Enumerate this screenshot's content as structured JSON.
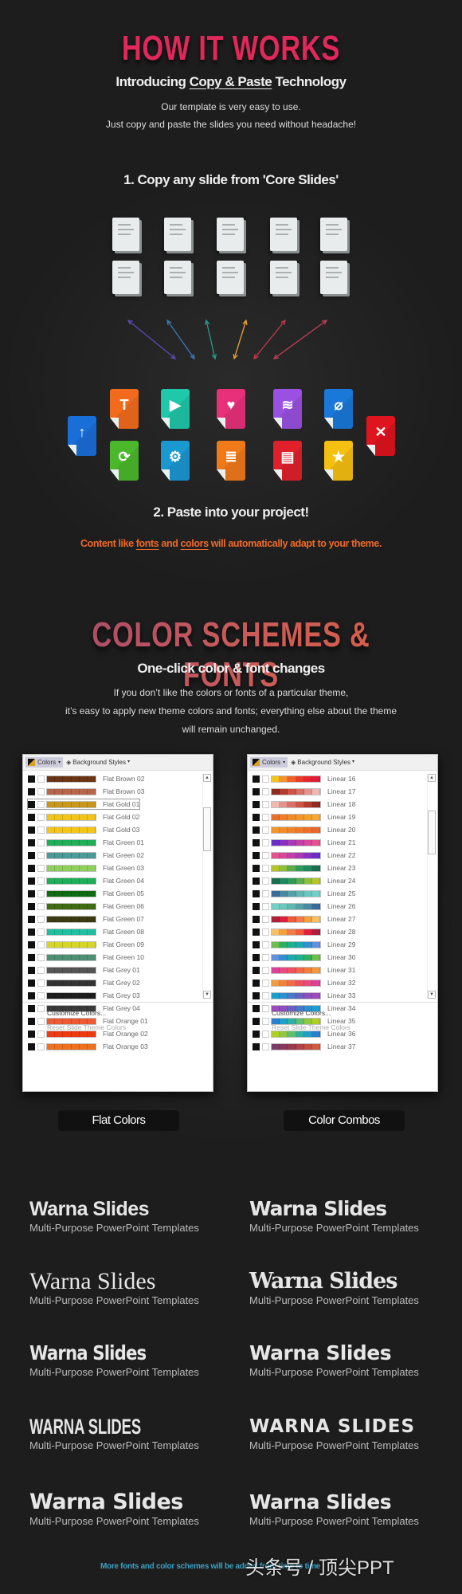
{
  "how": {
    "title": "HOW IT WORKS",
    "subtitle_pre": "Introducing ",
    "subtitle_link": "Copy & Paste",
    "subtitle_post": " Technology",
    "body_lines": [
      "Our template is very easy to use.",
      "Just copy and paste the slides you need without headache!"
    ],
    "step1": "1. Copy any slide from 'Core Slides'",
    "step2": "2. Paste into your project!",
    "adapt_pre": "Content like ",
    "adapt_fonts": "fonts",
    "adapt_mid": " and ",
    "adapt_colors": "colors",
    "adapt_post": " will automatically adapt to your theme.",
    "title_color": "#e0285a",
    "adapt_color": "#ee6a2a"
  },
  "doc_icon_count": 10,
  "arrow_colors": [
    "#5a4ab8",
    "#3a7ab8",
    "#2a9a8a",
    "#e8a030",
    "#c03a4a",
    "#c0405a"
  ],
  "file_icons": [
    {
      "name": "text",
      "glyph": "T",
      "color": "#f26b1d"
    },
    {
      "name": "play",
      "glyph": "▶",
      "color": "#1fc8a8"
    },
    {
      "name": "heart",
      "glyph": "♥",
      "color": "#e8307a"
    },
    {
      "name": "wifi",
      "glyph": "≋",
      "color": "#9a50e0"
    },
    {
      "name": "paperclip",
      "glyph": "⌀",
      "color": "#1a78d8"
    },
    {
      "name": "refresh",
      "glyph": "⟳",
      "color": "#4ab82a"
    },
    {
      "name": "gear",
      "glyph": "⚙",
      "color": "#1a98d0"
    },
    {
      "name": "document",
      "glyph": "≣",
      "color": "#f07a1a"
    },
    {
      "name": "table",
      "glyph": "▤",
      "color": "#e0202a"
    },
    {
      "name": "star",
      "glyph": "★",
      "color": "#f5c010"
    },
    {
      "name": "upload",
      "glyph": "↑",
      "color": "#1a6ed8"
    },
    {
      "name": "close",
      "glyph": "✕",
      "color": "#e0141e"
    }
  ],
  "schemes": {
    "title": "COLOR SCHEMES & FONTS",
    "subtitle": "One-click color & font changes",
    "body_lines": [
      "If you don’t like the colors or fonts of a particular theme,",
      "it’s easy to apply new theme colors and fonts; everything else about the theme",
      "will remain unchanged."
    ]
  },
  "panel_common": {
    "colors_btn": "Colors",
    "bg_styles": "Background Styles",
    "customize": "Customize Colors...",
    "reset": "Reset Slide Theme Colors"
  },
  "flat_panel": {
    "label": "Flat Colors",
    "rows": [
      {
        "name": "Flat Brown 02",
        "colors": [
          "#6b3515"
        ]
      },
      {
        "name": "Flat Brown 03",
        "colors": [
          "#b8664a"
        ]
      },
      {
        "name": "Flat Gold 01",
        "colors": [
          "#c9981a"
        ]
      },
      {
        "name": "Flat Gold 02",
        "colors": [
          "#f2c419"
        ]
      },
      {
        "name": "Flat Gold 03",
        "colors": [
          "#f5c518"
        ]
      },
      {
        "name": "Flat Green 01",
        "colors": [
          "#1fae5a"
        ]
      },
      {
        "name": "Flat Green 02",
        "colors": [
          "#4a9b98"
        ]
      },
      {
        "name": "Flat Green 03",
        "colors": [
          "#8fd05a"
        ]
      },
      {
        "name": "Flat Green 04",
        "colors": [
          "#1fae5a"
        ]
      },
      {
        "name": "Flat Green 05",
        "colors": [
          "#0e6b12"
        ]
      },
      {
        "name": "Flat Green 06",
        "colors": [
          "#3f6b12"
        ]
      },
      {
        "name": "Flat Green 07",
        "colors": [
          "#3b3a10"
        ]
      },
      {
        "name": "Flat Green 08",
        "colors": [
          "#1ec0a0"
        ]
      },
      {
        "name": "Flat Green 09",
        "colors": [
          "#d6d62a"
        ]
      },
      {
        "name": "Flat Green 10",
        "colors": [
          "#4e8f72"
        ]
      },
      {
        "name": "Flat Grey 01",
        "colors": [
          "#555555"
        ]
      },
      {
        "name": "Flat Grey 02",
        "colors": [
          "#333333"
        ]
      },
      {
        "name": "Flat Grey 03",
        "colors": [
          "#1e1e1e"
        ]
      },
      {
        "name": "Flat Grey 04",
        "colors": [
          "#3a3a3a"
        ]
      },
      {
        "name": "Flat Orange 01",
        "colors": [
          "#ee5a35"
        ]
      },
      {
        "name": "Flat Orange 02",
        "colors": [
          "#ee3a12"
        ]
      },
      {
        "name": "Flat Orange 03",
        "colors": [
          "#ee7020"
        ]
      }
    ]
  },
  "combo_panel": {
    "label": "Color Combos",
    "rows": [
      {
        "name": "Linear 16",
        "colors": [
          "#f7c51a",
          "#f3912b",
          "#ef5f2a",
          "#ea3b2a",
          "#e8232e",
          "#e01b3a"
        ]
      },
      {
        "name": "Linear 17",
        "colors": [
          "#8e2a1f",
          "#b53a2e",
          "#cc5548",
          "#d9706a",
          "#e4938e",
          "#f0b8b0"
        ]
      },
      {
        "name": "Linear 18",
        "colors": [
          "#f0b8b0",
          "#e4938e",
          "#d9706a",
          "#cc5548",
          "#b53a2e",
          "#8e2a1f"
        ]
      },
      {
        "name": "Linear 19",
        "colors": [
          "#e8702a",
          "#ee7e28",
          "#f08a28",
          "#f29528",
          "#f39f2a",
          "#f4a830"
        ]
      },
      {
        "name": "Linear 20",
        "colors": [
          "#f5962a",
          "#f28d2a",
          "#f0822a",
          "#ee7a2a",
          "#ec702a",
          "#ea682a"
        ]
      },
      {
        "name": "Linear 21",
        "colors": [
          "#6a2fc8",
          "#8a30c0",
          "#a83ab8",
          "#c040a8",
          "#d8489a",
          "#e85090"
        ]
      },
      {
        "name": "Linear 22",
        "colors": [
          "#e85090",
          "#d8489a",
          "#c040a8",
          "#a83ab8",
          "#8a30c0",
          "#6a2fc8"
        ]
      },
      {
        "name": "Linear 23",
        "colors": [
          "#b5c524",
          "#8cbf3a",
          "#5aac4e",
          "#2e9a5a",
          "#1e8a60",
          "#1a6e50"
        ]
      },
      {
        "name": "Linear 24",
        "colors": [
          "#1a6e50",
          "#1e8a60",
          "#2e9a5a",
          "#5aac4e",
          "#8cbf3a",
          "#b5c524"
        ]
      },
      {
        "name": "Linear 25",
        "colors": [
          "#3a6a9a",
          "#4a8aa0",
          "#55a0a8",
          "#60b8b0",
          "#6ac8c0",
          "#70d0c8"
        ]
      },
      {
        "name": "Linear 26",
        "colors": [
          "#70d0c8",
          "#6ac8c0",
          "#60b8b0",
          "#55a0a8",
          "#4a8aa0",
          "#3a6a9a"
        ]
      },
      {
        "name": "Linear 27",
        "colors": [
          "#b01e3a",
          "#e01e40",
          "#ee5a3a",
          "#f07a4a",
          "#f5a03a",
          "#f8c060"
        ]
      },
      {
        "name": "Linear 28",
        "colors": [
          "#f8c060",
          "#f5a03a",
          "#f07a4a",
          "#ee5a3a",
          "#e01e40",
          "#b01e3a"
        ]
      },
      {
        "name": "Linear 29",
        "colors": [
          "#6ac04a",
          "#2eb060",
          "#20b090",
          "#20a8b0",
          "#3090d0",
          "#6090e0"
        ]
      },
      {
        "name": "Linear 30",
        "colors": [
          "#6090e0",
          "#3090d0",
          "#20a8b0",
          "#20b090",
          "#2eb060",
          "#6ac04a"
        ]
      },
      {
        "name": "Linear 31",
        "colors": [
          "#e0409a",
          "#e84a80",
          "#ee5060",
          "#f06a4a",
          "#f2803a",
          "#f49a3a"
        ]
      },
      {
        "name": "Linear 32",
        "colors": [
          "#f49a3a",
          "#f2803a",
          "#f06a4a",
          "#ee5060",
          "#e84a80",
          "#e0409a"
        ]
      },
      {
        "name": "Linear 33",
        "colors": [
          "#1aa0d0",
          "#2a90d0",
          "#4a78c8",
          "#6a60c0",
          "#8a50c0",
          "#a048c0"
        ]
      },
      {
        "name": "Linear 34",
        "colors": [
          "#a048c0",
          "#8a50c0",
          "#6a60c0",
          "#4a78c8",
          "#2a90d0",
          "#1aa0d0"
        ]
      },
      {
        "name": "Linear 35",
        "colors": [
          "#2a80d0",
          "#20a0c8",
          "#30b0a0",
          "#60c070",
          "#90c840",
          "#b0d020"
        ]
      },
      {
        "name": "Linear 36",
        "colors": [
          "#b0d020",
          "#90c840",
          "#60c070",
          "#30b0a0",
          "#20a0c8",
          "#2a80d0"
        ]
      },
      {
        "name": "Linear 37",
        "colors": [
          "#7a3a6a",
          "#8a3a5a",
          "#9a3a50",
          "#b04448",
          "#c05040",
          "#d05a3a"
        ]
      }
    ]
  },
  "fonts": [
    {
      "title": "Warna Slides",
      "subtitle": "Multi-Purpose PowerPoint Templates"
    },
    {
      "title": "Warna Slides",
      "subtitle": "Multi-Purpose PowerPoint Templates"
    },
    {
      "title": "Warna Slides",
      "subtitle": "Multi-Purpose PowerPoint Templates"
    },
    {
      "title": "Warna Slides",
      "subtitle": "Multi-Purpose PowerPoint Templates"
    },
    {
      "title": "Warna Slides",
      "subtitle": "Multi-Purpose PowerPoint Templates"
    },
    {
      "title": "Warna Slides",
      "subtitle": "Multi-Purpose PowerPoint Templates"
    },
    {
      "title": "WARNA SLIDES",
      "subtitle": "Multi-Purpose PowerPoint Templates"
    },
    {
      "title": "WARNA SLIDES",
      "subtitle": "Multi-Purpose PowerPoint Templates"
    },
    {
      "title": "Warna Slides",
      "subtitle": "Multi-Purpose PowerPoint Templates"
    },
    {
      "title": "Warna Slides",
      "subtitle": "Multi-Purpose PowerPoint Templates"
    }
  ],
  "footer": {
    "text": "More fonts and color schemes will be added from time to time",
    "color": "#3aa0c0"
  },
  "watermark": "头条号 / 顶尖PPT"
}
